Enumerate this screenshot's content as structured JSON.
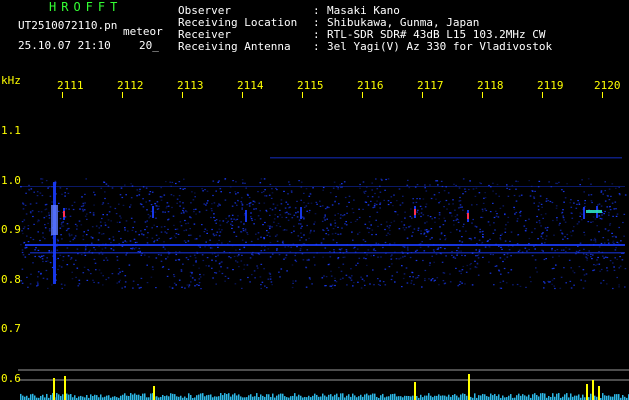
{
  "app": {
    "title": "HROFFT",
    "filename": "UT2510072110.pn",
    "meteor_tag": "meteor",
    "datetime": "25.10.07 21:10",
    "minute_tag": "20_"
  },
  "metadata": [
    {
      "label": "Observer",
      "value": "Masaki Kano"
    },
    {
      "label": "Receiving Location",
      "value": "Shibukawa, Gunma, Japan"
    },
    {
      "label": "Receiver",
      "value": "RTL-SDR SDR# 43dB L15 103.2MHz CW"
    },
    {
      "label": "Receiving Antenna",
      "value": "3el Yagi(V) Az 330 for Vladivostok"
    }
  ],
  "spectrogram": {
    "y_unit": "kHz",
    "y_ticks": [
      "1.1",
      "1.0",
      "0.9",
      "0.8",
      "0.7",
      "0.6"
    ],
    "x_ticks": [
      "2111",
      "2112",
      "2113",
      "2114",
      "2115",
      "2116",
      "2117",
      "2118",
      "2119",
      "2120"
    ],
    "colors": {
      "background": "#000000",
      "text_green": "#33ff33",
      "text_yellow": "#ffff00",
      "tick": "#ffff00",
      "noise": "#1a3cff",
      "echo": "#ff3050",
      "level_bars": "#33ccff"
    }
  }
}
